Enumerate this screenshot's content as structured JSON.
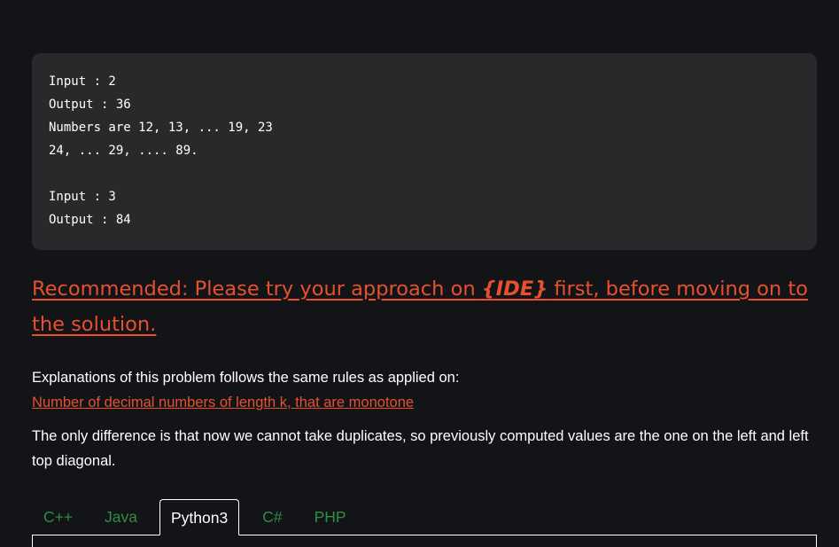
{
  "example": {
    "lines": [
      "Input : 2",
      "Output : 36",
      "Numbers are 12, 13, ... 19, 23",
      "24, ... 29, .... 89.",
      "",
      "Input : 3",
      "Output : 84"
    ]
  },
  "recommend": {
    "prefix": "Recommended: Please try your approach on ",
    "ide": "{IDE}",
    "suffix": " first, before moving on to the solution."
  },
  "explanation": {
    "intro": "Explanations of this problem follows the same rules as applied on:",
    "link": "Number of decimal numbers of length k, that are monotone",
    "detail": "The only difference is that now we cannot take duplicates, so previously computed values are the one on the left and left top diagonal."
  },
  "tabs": {
    "items": [
      "C++",
      "Java",
      "Python3",
      "C#",
      "PHP"
    ],
    "active": "Python3"
  },
  "colors": {
    "background": "#131417",
    "code_background": "#29292c",
    "accent_orange": "#e8502d",
    "tab_green": "#2f8d46"
  }
}
